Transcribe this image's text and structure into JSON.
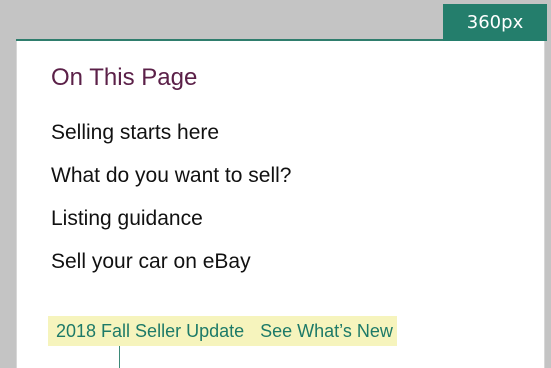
{
  "viewport_badge": {
    "label": "360px"
  },
  "on_this_page": {
    "title": "On This Page",
    "links": [
      "Selling starts here",
      "What do you want to sell?",
      "Listing guidance",
      "Sell your car on eBay"
    ]
  },
  "promo": {
    "left_link": "2018 Fall Seller Update",
    "right_link": "See What’s New"
  },
  "colors": {
    "background": "#c4c4c4",
    "teal": "#247e6c",
    "title": "#5b2048",
    "highlight": "#f6f4bd"
  }
}
